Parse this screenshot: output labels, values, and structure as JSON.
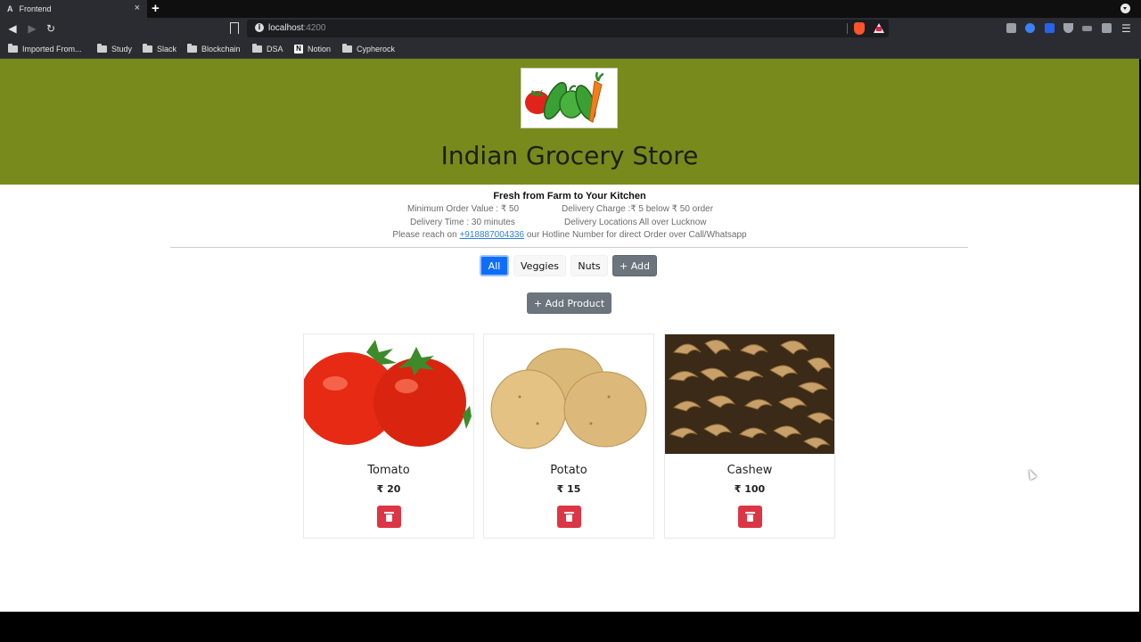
{
  "browser": {
    "tab_icon": "A",
    "tab_title": "Frontend",
    "tab_close": "×",
    "new_tab": "+",
    "url_host": "localhost",
    "url_port": ":4200",
    "bookmarks": [
      "Imported From...",
      "Study",
      "Slack",
      "Blockchain",
      "DSA",
      "Notion",
      "Cypherock"
    ],
    "extension_colors": [
      "#9aa0a6",
      "#3b82f6",
      "#2563eb",
      "#a0a4ab",
      "#8a8d93",
      "#9aa0a6"
    ]
  },
  "header": {
    "store_title": "Indian Grocery Store"
  },
  "info": {
    "tagline": "Fresh from Farm to Your Kitchen",
    "min_order": "Minimum Order Value : ₹ 50",
    "delivery_charge": "Delivery Charge :₹ 5 below ₹ 50 order",
    "delivery_time": "Delivery Time : 30 minutes",
    "delivery_locations": "Delivery Locations  All over Lucknow",
    "hotline_prefix": "Please reach on ",
    "hotline_number": "+918887004336",
    "hotline_suffix": " our Hotline Number for direct Order over Call/Whatsapp"
  },
  "categories": {
    "all": "All",
    "veggies": "Veggies",
    "nuts": "Nuts",
    "add": "+ Add"
  },
  "add_product_label": "+ Add Product",
  "products": [
    {
      "name": "Tomato",
      "price": "₹ 20"
    },
    {
      "name": "Potato",
      "price": "₹ 15"
    },
    {
      "name": "Cashew",
      "price": "₹ 100"
    }
  ],
  "colors": {
    "header_bg": "#788a1c",
    "primary": "#0d6efd",
    "secondary": "#6c757d",
    "danger": "#dc3545"
  }
}
